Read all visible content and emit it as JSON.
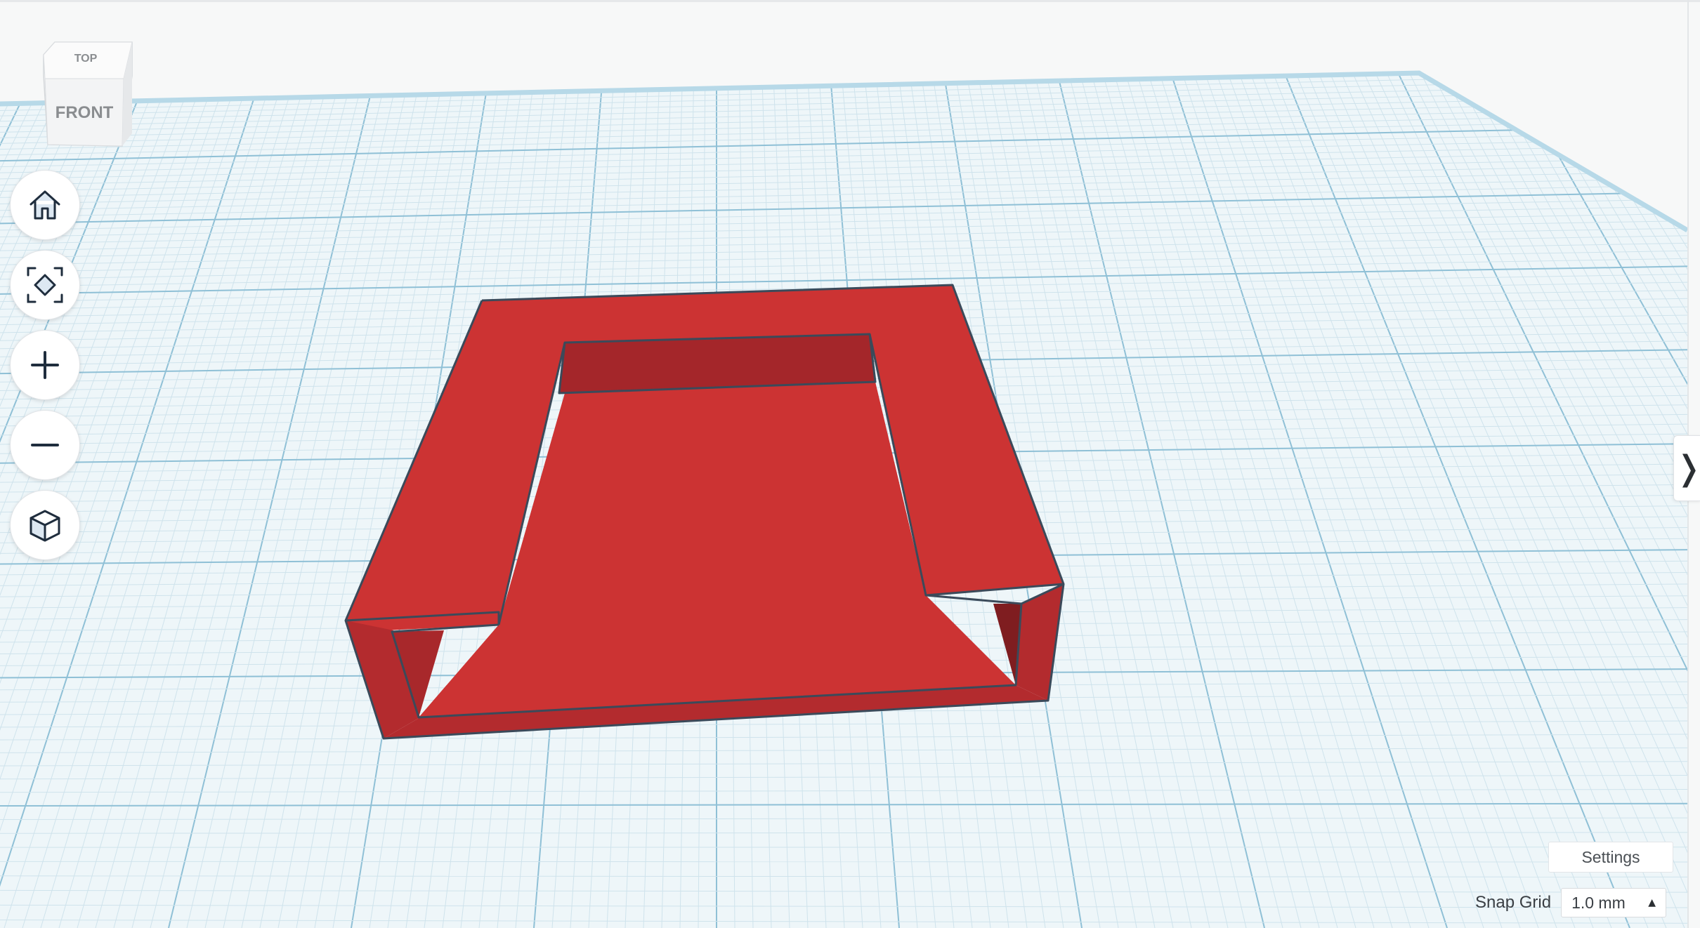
{
  "viewcube": {
    "top_label": "TOP",
    "front_label": "FRONT"
  },
  "toolbar": {
    "buttons": [
      {
        "name": "home-view-button",
        "icon": "home-icon"
      },
      {
        "name": "fit-view-button",
        "icon": "fit-to-view-icon"
      },
      {
        "name": "zoom-in-button",
        "icon": "plus-icon"
      },
      {
        "name": "zoom-out-button",
        "icon": "minus-icon"
      },
      {
        "name": "projection-button",
        "icon": "perspective-cube-icon"
      }
    ]
  },
  "right_panel": {
    "toggle_glyph": "❭"
  },
  "settings": {
    "label": "Settings"
  },
  "snap_grid": {
    "label": "Snap Grid",
    "value": "1.0 mm"
  },
  "scene": {
    "object_color": "#cc3333",
    "object_side_color": "#a8282b",
    "object_dark_color": "#7f1d20",
    "edge_color": "#3b4a5a",
    "grid_bg": "#eef6f9",
    "grid_minor": "#cfe3ec",
    "grid_major": "#8fc0d6",
    "workplane_border": "#b7d9e8"
  }
}
